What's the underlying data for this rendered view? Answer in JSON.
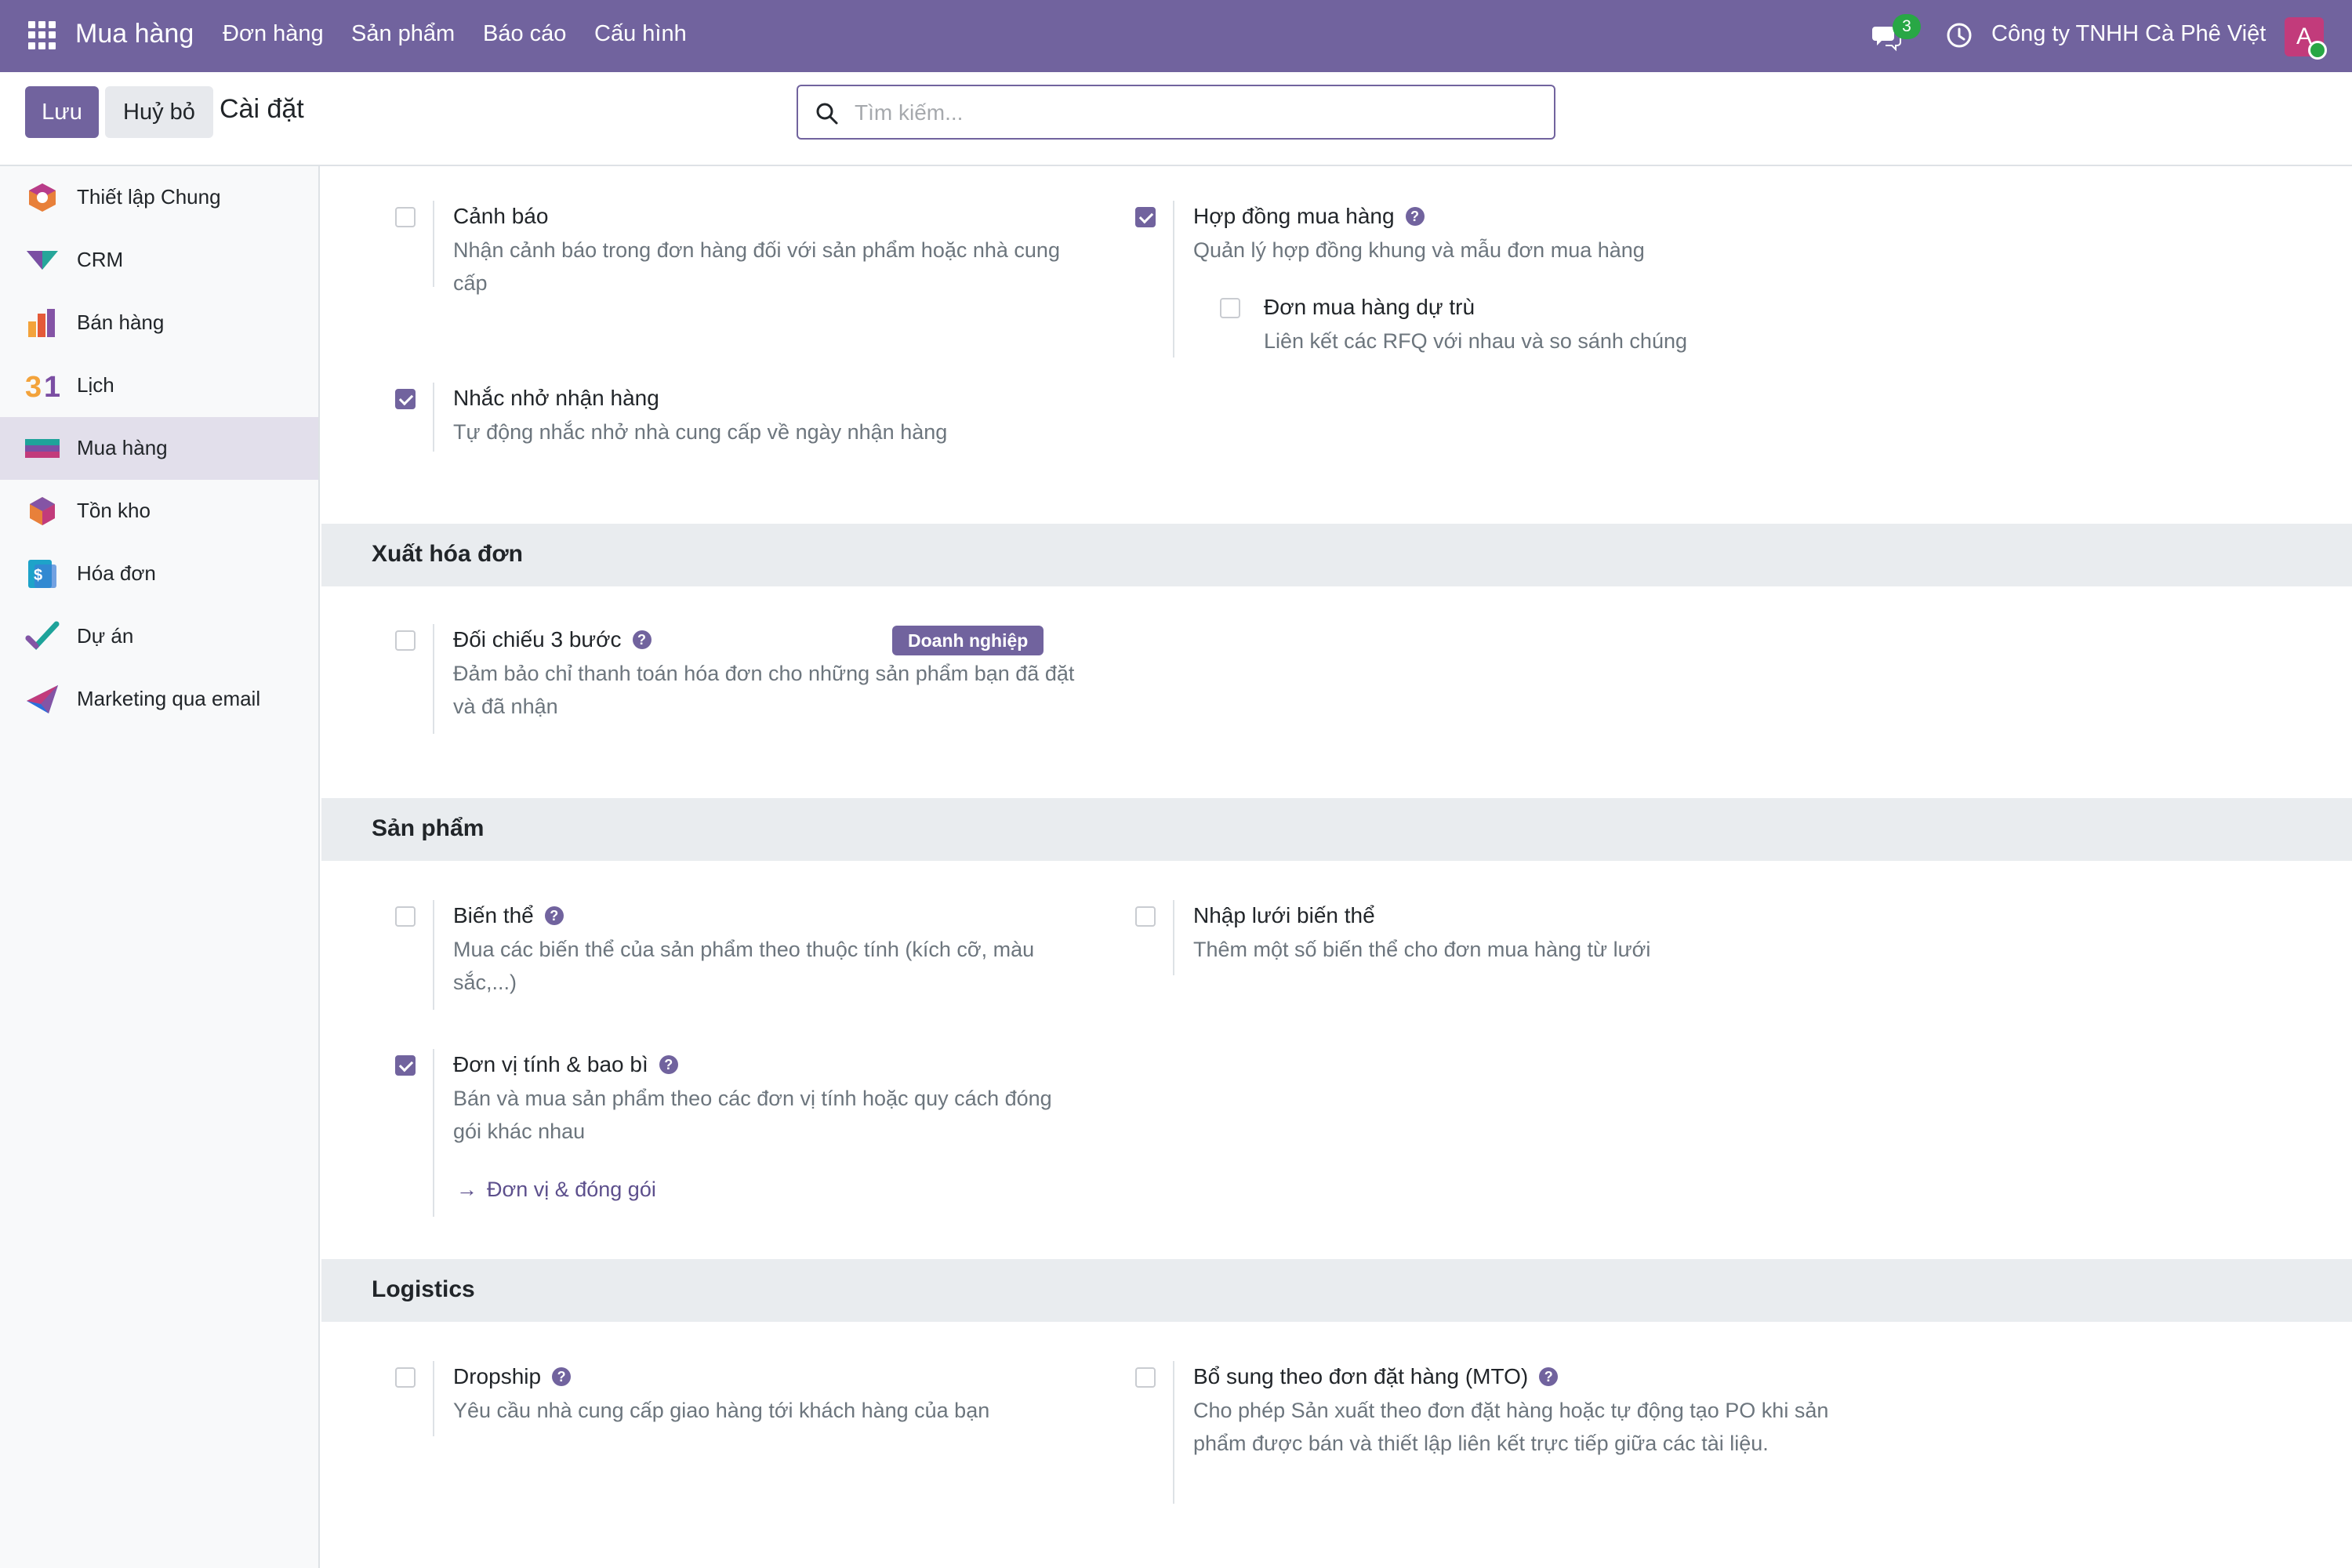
{
  "navbar": {
    "brand": "Mua hàng",
    "menu": [
      "Đơn hàng",
      "Sản phẩm",
      "Báo cáo",
      "Cấu hình"
    ],
    "chat_count": "3",
    "company": "Công ty TNHH Cà Phê Việt",
    "avatar_letter": "A",
    "accent_color": "#71639e"
  },
  "control": {
    "save_label": "Lưu",
    "cancel_label": "Huỷ bỏ",
    "title": "Cài đặt",
    "search_placeholder": "Tìm kiếm..."
  },
  "sidebar": {
    "items": [
      {
        "label": "Thiết lập Chung",
        "icon": "settings-app-icon"
      },
      {
        "label": "CRM",
        "icon": "crm-app-icon"
      },
      {
        "label": "Bán hàng",
        "icon": "sales-app-icon"
      },
      {
        "label": "Lịch",
        "icon": "calendar-app-icon"
      },
      {
        "label": "Mua hàng",
        "icon": "purchase-app-icon",
        "active": true
      },
      {
        "label": "Tồn kho",
        "icon": "inventory-app-icon"
      },
      {
        "label": "Hóa đơn",
        "icon": "invoicing-app-icon"
      },
      {
        "label": "Dự án",
        "icon": "project-app-icon"
      },
      {
        "label": "Marketing qua email",
        "icon": "email-marketing-app-icon"
      }
    ]
  },
  "settings": {
    "warning": {
      "title": "Cảnh báo",
      "desc": "Nhận cảnh báo trong đơn hàng đối với sản phẩm hoặc nhà cung cấp",
      "checked": false
    },
    "agreements": {
      "title": "Hợp đồng mua hàng",
      "desc": "Quản lý hợp đồng khung và mẫu đơn mua hàng",
      "checked": true
    },
    "alt_po": {
      "title": "Đơn mua hàng dự trù",
      "desc": "Liên kết các RFQ với nhau và so sánh chúng",
      "checked": false
    },
    "receipt_reminder": {
      "title": "Nhắc nhở nhận hàng",
      "desc": "Tự động nhắc nhở nhà cung cấp về ngày nhận hàng",
      "checked": true
    }
  },
  "invoicing": {
    "section_title": "Xuất hóa đơn",
    "three_way": {
      "title": "Đối chiếu 3 bước",
      "desc": "Đảm bảo chỉ thanh toán hóa đơn cho những sản phẩm bạn đã đặt và đã nhận",
      "badge": "Doanh nghiệp",
      "checked": false
    }
  },
  "products": {
    "section_title": "Sản phẩm",
    "variants": {
      "title": "Biến thể",
      "desc": "Mua các biến thể của sản phẩm theo thuộc tính (kích cỡ, màu sắc,...)",
      "checked": false
    },
    "variant_grid": {
      "title": "Nhập lưới biến thể",
      "desc": "Thêm một số biến thể cho đơn mua hàng từ lưới",
      "checked": false
    },
    "uom": {
      "title": "Đơn vị tính & bao bì",
      "desc": "Bán và mua sản phẩm theo các đơn vị tính hoặc quy cách đóng gói khác nhau",
      "checked": true,
      "link": "Đơn vị & đóng gói"
    }
  },
  "logistics": {
    "section_title": "Logistics",
    "dropship": {
      "title": "Dropship",
      "desc": "Yêu cầu nhà cung cấp giao hàng tới khách hàng của bạn",
      "checked": false
    },
    "mto": {
      "title": "Bổ sung theo đơn đặt hàng (MTO)",
      "desc": "Cho phép Sản xuất theo đơn đặt hàng hoặc tự động tạo PO khi sản phẩm được bán và thiết lập liên kết trực tiếp giữa các tài liệu.",
      "checked": false
    }
  }
}
